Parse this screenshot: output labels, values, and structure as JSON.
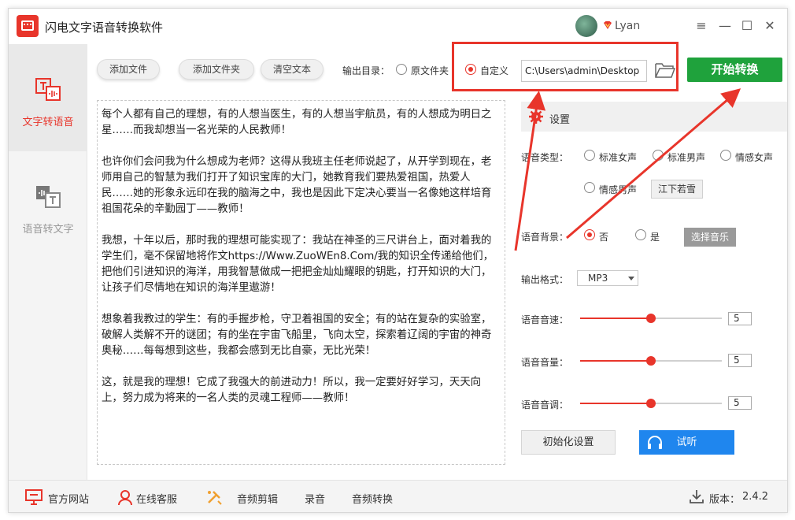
{
  "app": {
    "title": "闪电文字语音转换软件",
    "user_name": "Lyan",
    "window_controls": [
      "menu-icon",
      "minimize-icon",
      "maximize-icon",
      "close-icon"
    ]
  },
  "sidebar": {
    "items": [
      {
        "label": "文字转语音",
        "icon": "text-to-speech-icon",
        "active": true
      },
      {
        "label": "语音转文字",
        "icon": "speech-to-text-icon",
        "active": false
      }
    ]
  },
  "toolbar": {
    "add_file": "添加文件",
    "add_folder": "添加文件夹",
    "clear_text": "清空文本",
    "output_dir_label": "输出目录：",
    "option_original": "原文件夹",
    "option_custom": "自定义",
    "output_path": "C:\\Users\\admin\\Desktop",
    "selected_output": "custom",
    "start": "开始转换"
  },
  "text_content": {
    "paragraphs": [
      "每个人都有自己的理想，有的人想当医生，有的人想当宇航员，有的人想成为明日之星……而我却想当一名光荣的人民教师！",
      "也许你们会问我为什么想成为老师？这得从我班主任老师说起了，从开学到现在，老师用自己的智慧为我们打开了知识宝库的大门，她教育我们要热爱祖国，热爱人民……她的形象永远印在我的脑海之中，我也是因此下定决心要当一名像她这样培育祖国花朵的辛勤园丁——教师！",
      "我想，十年以后，那时我的理想可能实现了：我站在神圣的三尺讲台上，面对着我的学生们，毫不保留地将作文https://Www.ZuoWEn8.Com/我的知识全传递给他们，把他们引进知识的海洋，用我智慧做成一把把金灿灿耀眼的钥匙，打开知识的大门，让孩子们尽情地在知识的海洋里遨游！",
      "想象着我教过的学生：有的手握步枪，守卫着祖国的安全；有的站在复杂的实验室，破解人类解不开的谜团；有的坐在宇宙飞船里，飞向太空，探索着辽阔的宇宙的神奇奥秘……每每想到这些，我都会感到无比自豪，无比光荣！",
      "这，就是我的理想！它成了我强大的前进动力！所以，我一定要好好学习，天天向上，努力成为将来的一名人类的灵魂工程师——教师！"
    ]
  },
  "settings": {
    "title": "设置",
    "voice_type_label": "语音类型：",
    "voice_types": [
      "标准女声",
      "标准男声",
      "情感女声",
      "情感男声"
    ],
    "voice_preset": "江下若雪",
    "bg_label": "语音背景：",
    "bg_no": "否",
    "bg_yes": "是",
    "bg_selected": "no",
    "choose_music": "选择音乐",
    "format_label": "输出格式：",
    "format_value": "MP3",
    "speed_label": "语音音速：",
    "speed_value": "5",
    "volume_label": "语音音量：",
    "volume_value": "5",
    "pitch_label": "语音音调：",
    "pitch_value": "5",
    "slider_fraction": 0.5,
    "reset": "初始化设置",
    "listen": "试听"
  },
  "footer": {
    "website": "官方网站",
    "support": "在线客服",
    "audio_edit": "音频剪辑",
    "record": "录音",
    "audio_convert": "音频转换",
    "version_label": "版本：",
    "version": "2.4.2"
  },
  "colors": {
    "accent_red": "#e8352b",
    "start_green": "#1fa23c",
    "listen_blue": "#1f86ee"
  }
}
